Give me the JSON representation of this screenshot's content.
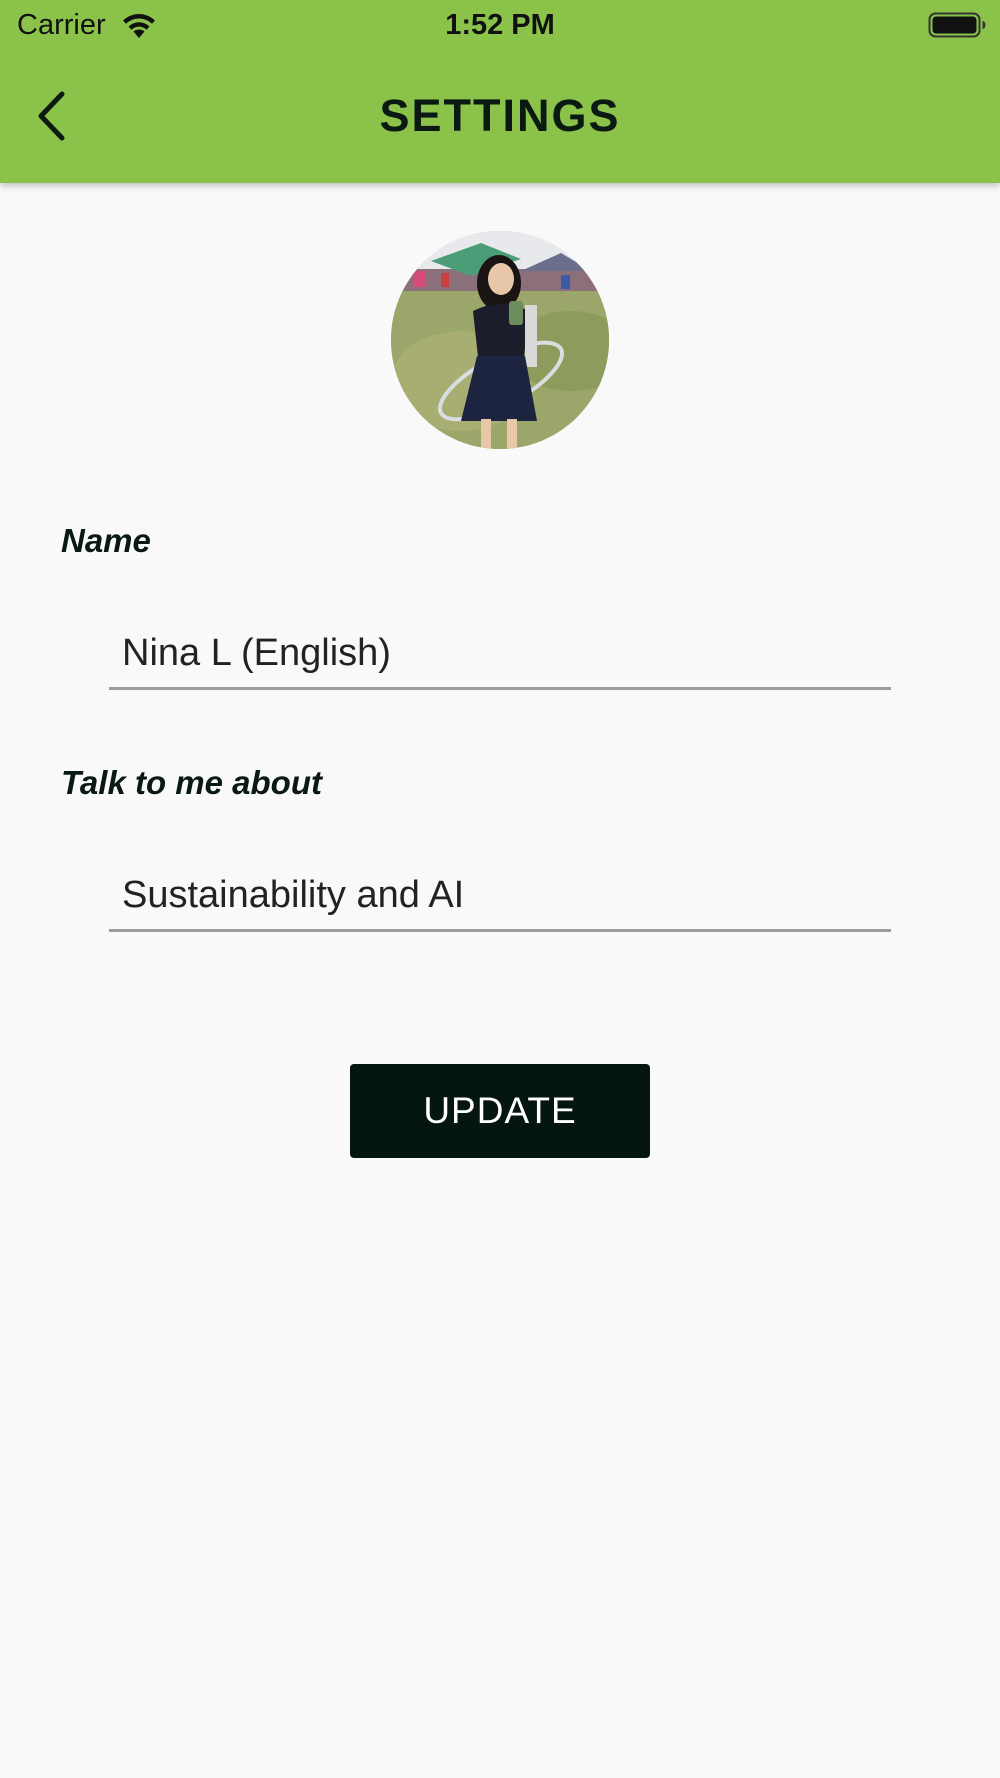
{
  "status_bar": {
    "carrier": "Carrier",
    "time": "1:52 PM",
    "wifi_icon": "wifi-icon",
    "battery_icon": "battery-icon"
  },
  "header": {
    "title": "SETTINGS",
    "back_icon": "chevron-left-icon",
    "background_color": "#8bc34a"
  },
  "profile": {
    "avatar_icon": "profile-photo"
  },
  "form": {
    "name_label": "Name",
    "name_value": "Nina L (English)",
    "topic_label": "Talk to me about",
    "topic_value": "Sustainability and AI"
  },
  "actions": {
    "update_label": "UPDATE",
    "button_color": "#051510"
  }
}
